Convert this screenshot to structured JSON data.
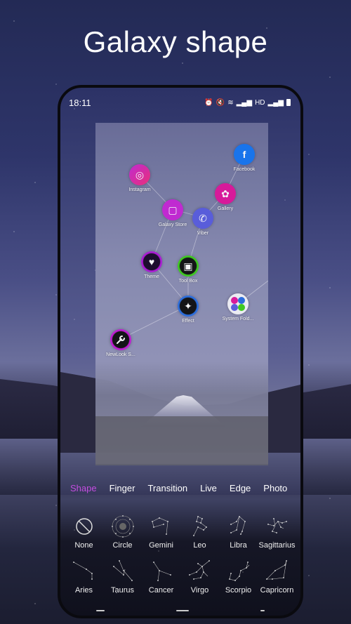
{
  "headline": "Galaxy shape",
  "status_bar": {
    "time": "18:11",
    "icons": [
      "alarm-icon",
      "mute-icon",
      "wifi-icon",
      "4g-signal-icon",
      "hd-icon",
      "5g-signal-icon",
      "battery-icon"
    ]
  },
  "apps": [
    {
      "name": "Facebook",
      "icon": "facebook-icon",
      "glyph": "f",
      "color": "#1877f2"
    },
    {
      "name": "Instagram",
      "icon": "instagram-icon",
      "glyph": "◎",
      "color": "#d62fa8"
    },
    {
      "name": "Gallery",
      "icon": "gallery-icon",
      "glyph": "✿",
      "color": "#e0189c"
    },
    {
      "name": "Galaxy Store",
      "icon": "galaxy-store-icon",
      "glyph": "▢",
      "color": "#c729d6"
    },
    {
      "name": "Viber",
      "icon": "viber-icon",
      "glyph": "✆",
      "color": "#5b5fe0"
    },
    {
      "name": "Theme",
      "icon": "theme-icon",
      "glyph": "♥",
      "color": "#a11bd0"
    },
    {
      "name": "Tool Box",
      "icon": "toolbox-icon",
      "glyph": "▣",
      "color": "#3ecf1c"
    },
    {
      "name": "Effect",
      "icon": "effect-icon",
      "glyph": "✦",
      "color": "#2b6fe0"
    },
    {
      "name": "System Fold...",
      "icon": "system-folder-icon",
      "glyph": "⁘",
      "color": "#f4f4f8"
    },
    {
      "name": "NewLook S...",
      "icon": "newlook-settings-icon",
      "glyph": "🔧",
      "color": "#b41ac4"
    }
  ],
  "tabs": [
    {
      "label": "Shape",
      "active": true
    },
    {
      "label": "Finger",
      "active": false
    },
    {
      "label": "Transition",
      "active": false
    },
    {
      "label": "Live",
      "active": false
    },
    {
      "label": "Edge",
      "active": false
    },
    {
      "label": "Photo",
      "active": false
    }
  ],
  "shapes": [
    {
      "label": "None",
      "icon": "none-icon"
    },
    {
      "label": "Circle",
      "icon": "circle-icon"
    },
    {
      "label": "Gemini",
      "icon": "gemini-constellation-icon"
    },
    {
      "label": "Leo",
      "icon": "leo-constellation-icon"
    },
    {
      "label": "Libra",
      "icon": "libra-constellation-icon"
    },
    {
      "label": "Sagittarius",
      "icon": "sagittarius-constellation-icon"
    },
    {
      "label": "Aries",
      "icon": "aries-constellation-icon"
    },
    {
      "label": "Taurus",
      "icon": "taurus-constellation-icon"
    },
    {
      "label": "Cancer",
      "icon": "cancer-constellation-icon"
    },
    {
      "label": "Virgo",
      "icon": "virgo-constellation-icon"
    },
    {
      "label": "Scorpio",
      "icon": "scorpio-constellation-icon"
    },
    {
      "label": "Capricorn",
      "icon": "capricorn-constellation-icon"
    }
  ],
  "colors": {
    "accent": "#c44de0"
  }
}
